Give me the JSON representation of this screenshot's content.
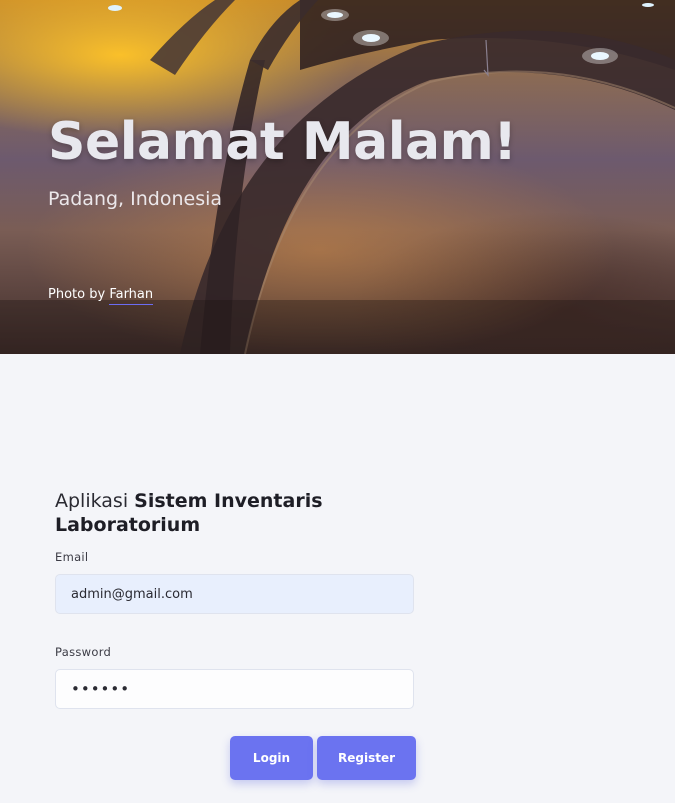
{
  "hero": {
    "greeting": "Selamat Malam!",
    "location": "Padang, Indonesia",
    "credit_prefix": "Photo by",
    "credit_author": "Farhan"
  },
  "login": {
    "app_title_prefix": "Aplikasi",
    "app_title_bold": "Sistem Inventaris Laboratorium",
    "email_label": "Email",
    "email_value": "admin@gmail.com",
    "password_label": "Password",
    "password_value": "••••••",
    "login_button": "Login",
    "register_button": "Register"
  },
  "colors": {
    "accent": "#6b73f0",
    "page_background": "#f4f5f9",
    "email_field_background": "#e8effd"
  }
}
